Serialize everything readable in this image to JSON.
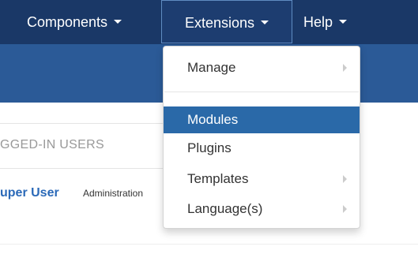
{
  "navbar": {
    "items": [
      {
        "label": "Components"
      },
      {
        "label": "Extensions"
      },
      {
        "label": "Help"
      }
    ]
  },
  "panel": {
    "header": "GGED-IN USERS",
    "user_name": "uper User",
    "user_role": "Administration"
  },
  "dropdown": {
    "items": [
      {
        "label": "Manage",
        "has_submenu": true
      },
      {
        "label": "Modules",
        "active": true
      },
      {
        "label": "Plugins"
      },
      {
        "label": "Templates",
        "has_submenu": true
      },
      {
        "label": "Language(s)",
        "has_submenu": true
      }
    ]
  },
  "colors": {
    "navbar_bg": "#1a3867",
    "subbar_bg": "#2b5a97",
    "active_item": "#2a69a8",
    "link": "#2a69b8"
  },
  "icons": [
    "caret-down-icon",
    "chevron-right-icon"
  ]
}
